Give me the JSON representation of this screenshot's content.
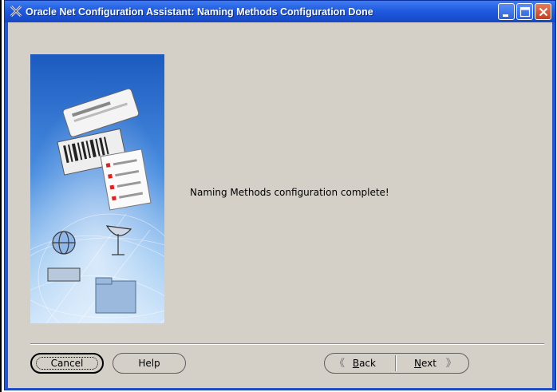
{
  "window": {
    "title": "Oracle Net Configuration Assistant: Naming Methods Configuration Done",
    "controls": [
      "minimize-icon",
      "maximize-icon",
      "close-icon"
    ]
  },
  "content": {
    "message": "Naming Methods configuration complete!"
  },
  "buttons": {
    "cancel": "Cancel",
    "help": "Help",
    "back_prefix": "",
    "back_mnemonic": "B",
    "back_rest": "ack",
    "next_mnemonic": "N",
    "next_rest": "ext"
  },
  "icons": {
    "back": "chevron-left-icon",
    "next": "chevron-right-icon"
  },
  "colors": {
    "titlebar": "#2356d4",
    "dialog_bg": "#d4d0c8",
    "banner_blue": "#2f6fcf"
  }
}
